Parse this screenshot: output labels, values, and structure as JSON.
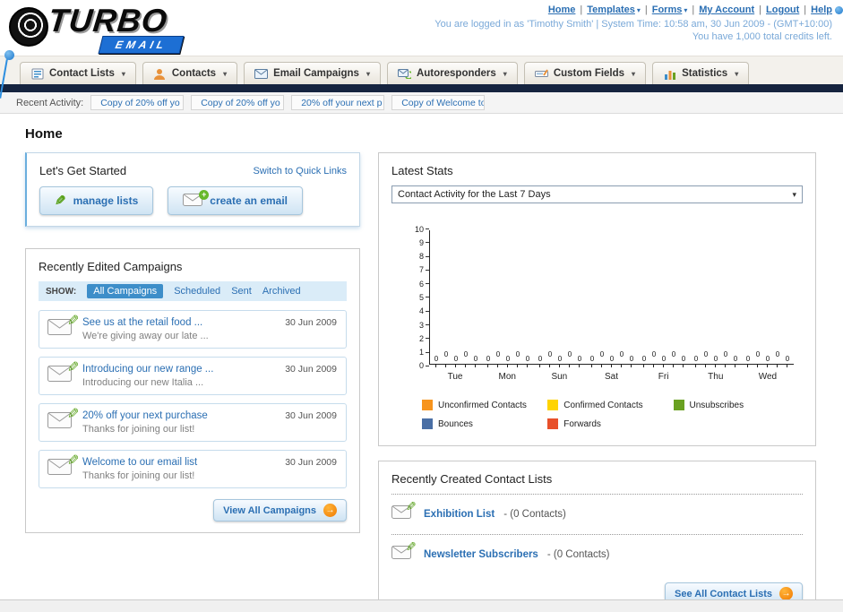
{
  "header": {
    "logo": {
      "line1": "TURBO",
      "line2": "EMAIL"
    },
    "nav": [
      "Home",
      "Templates",
      "Forms",
      "My Account",
      "Logout",
      "Help"
    ],
    "login_info": "You are logged in as 'Timothy Smith' | System Time: 10:58 am, 30 Jun 2009 - (GMT+10:00)",
    "credits": "You have 1,000 total credits left."
  },
  "tabs": [
    {
      "label": "Contact Lists",
      "icon": "contact-lists-icon"
    },
    {
      "label": "Contacts",
      "icon": "contacts-icon"
    },
    {
      "label": "Email Campaigns",
      "icon": "email-campaigns-icon"
    },
    {
      "label": "Autoresponders",
      "icon": "autoresponders-icon"
    },
    {
      "label": "Custom Fields",
      "icon": "custom-fields-icon"
    },
    {
      "label": "Statistics",
      "icon": "statistics-icon"
    }
  ],
  "recent_activity": {
    "label": "Recent Activity:",
    "items": [
      "Copy of 20% off yo",
      "Copy of 20% off yo",
      "20% off your next p",
      "Copy of Welcome to"
    ]
  },
  "page_title": "Home",
  "get_started": {
    "title": "Let's Get Started",
    "switch_link": "Switch to Quick Links",
    "buttons": [
      {
        "label": "manage lists",
        "icon": "pencil-icon"
      },
      {
        "label": "create an email",
        "icon": "envelope-plus-icon"
      }
    ]
  },
  "campaigns": {
    "title": "Recently Edited Campaigns",
    "show_label": "SHOW:",
    "filters": [
      "All Campaigns",
      "Scheduled",
      "Sent",
      "Archived"
    ],
    "active_filter": "All Campaigns",
    "items": [
      {
        "title": "See us at the retail food ...",
        "subtitle": "We're giving away our late ...",
        "date": "30 Jun 2009"
      },
      {
        "title": "Introducing our new range ...",
        "subtitle": "Introducing our new Italia ...",
        "date": "30 Jun 2009"
      },
      {
        "title": "20% off your next purchase",
        "subtitle": "Thanks for joining our list!",
        "date": "30 Jun 2009"
      },
      {
        "title": "Welcome to our email list",
        "subtitle": "Thanks for joining our list!",
        "date": "30 Jun 2009"
      }
    ],
    "view_all": "View All Campaigns"
  },
  "stats": {
    "title": "Latest Stats",
    "dropdown_value": "Contact Activity for the Last 7 Days",
    "legend": [
      {
        "label": "Unconfirmed Contacts",
        "color": "#f7941d"
      },
      {
        "label": "Confirmed Contacts",
        "color": "#ffd400"
      },
      {
        "label": "Unsubscribes",
        "color": "#6aa121"
      },
      {
        "label": "Bounces",
        "color": "#4a6fa5"
      },
      {
        "label": "Forwards",
        "color": "#e8502a"
      }
    ]
  },
  "chart_data": {
    "type": "bar",
    "title": "Contact Activity for the Last 7 Days",
    "categories": [
      "Tue",
      "Mon",
      "Sun",
      "Sat",
      "Fri",
      "Thu",
      "Wed"
    ],
    "series": [
      {
        "name": "Unconfirmed Contacts",
        "color": "#f7941d",
        "values": [
          0,
          0,
          0,
          0,
          0,
          0,
          0
        ]
      },
      {
        "name": "Confirmed Contacts",
        "color": "#ffd400",
        "values": [
          0,
          0,
          0,
          0,
          0,
          0,
          0
        ]
      },
      {
        "name": "Unsubscribes",
        "color": "#6aa121",
        "values": [
          0,
          0,
          0,
          0,
          0,
          0,
          0
        ]
      },
      {
        "name": "Bounces",
        "color": "#4a6fa5",
        "values": [
          0,
          0,
          0,
          0,
          0,
          0,
          0
        ]
      },
      {
        "name": "Forwards",
        "color": "#e8502a",
        "values": [
          0,
          0,
          0,
          0,
          0,
          0,
          0
        ]
      }
    ],
    "ylim": [
      0,
      10
    ],
    "yticks": [
      0,
      1,
      2,
      3,
      4,
      5,
      6,
      7,
      8,
      9,
      10
    ],
    "grid": false,
    "legend_position": "bottom"
  },
  "contact_lists": {
    "title": "Recently Created Contact Lists",
    "items": [
      {
        "name": "Exhibition List",
        "suffix": "- (0 Contacts)"
      },
      {
        "name": "Newsletter Subscribers",
        "suffix": "- (0 Contacts)"
      }
    ],
    "see_all": "See All Contact Lists"
  }
}
